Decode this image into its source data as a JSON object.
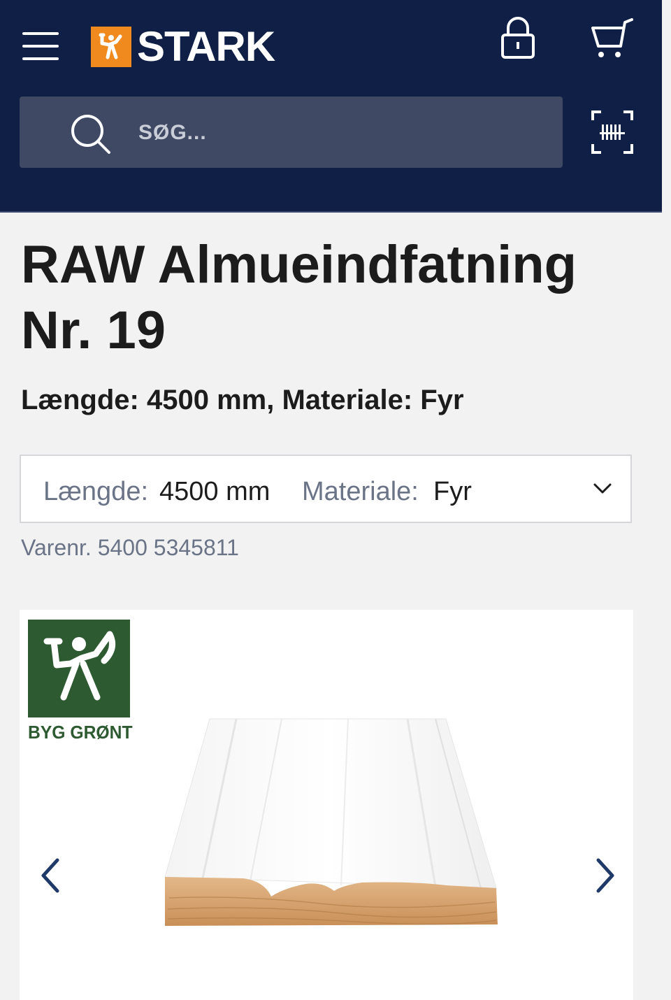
{
  "header": {
    "brand": "STARK",
    "search": {
      "placeholder": "SØG..."
    },
    "icons": [
      "menu-icon",
      "lock-icon",
      "cart-icon",
      "search-icon",
      "barcode-scan-icon"
    ]
  },
  "product": {
    "title": "RAW Almueindfatning Nr. 19",
    "subtitle": "Længde: 4500 mm, Materiale: Fyr",
    "variant": {
      "length_label": "Længde:",
      "length_value": "4500 mm",
      "material_label": "Materiale:",
      "material_value": "Fyr"
    },
    "item_number": "Varenr. 5400 5345811"
  },
  "gallery": {
    "badge": "BYG GRØNT",
    "icons": [
      "chevron-left-icon",
      "chevron-right-icon",
      "chevron-down-icon"
    ]
  },
  "colors": {
    "header_bg": "#0f1f45",
    "brand_orange": "#f08a1e",
    "badge_green": "#2e5a32"
  }
}
